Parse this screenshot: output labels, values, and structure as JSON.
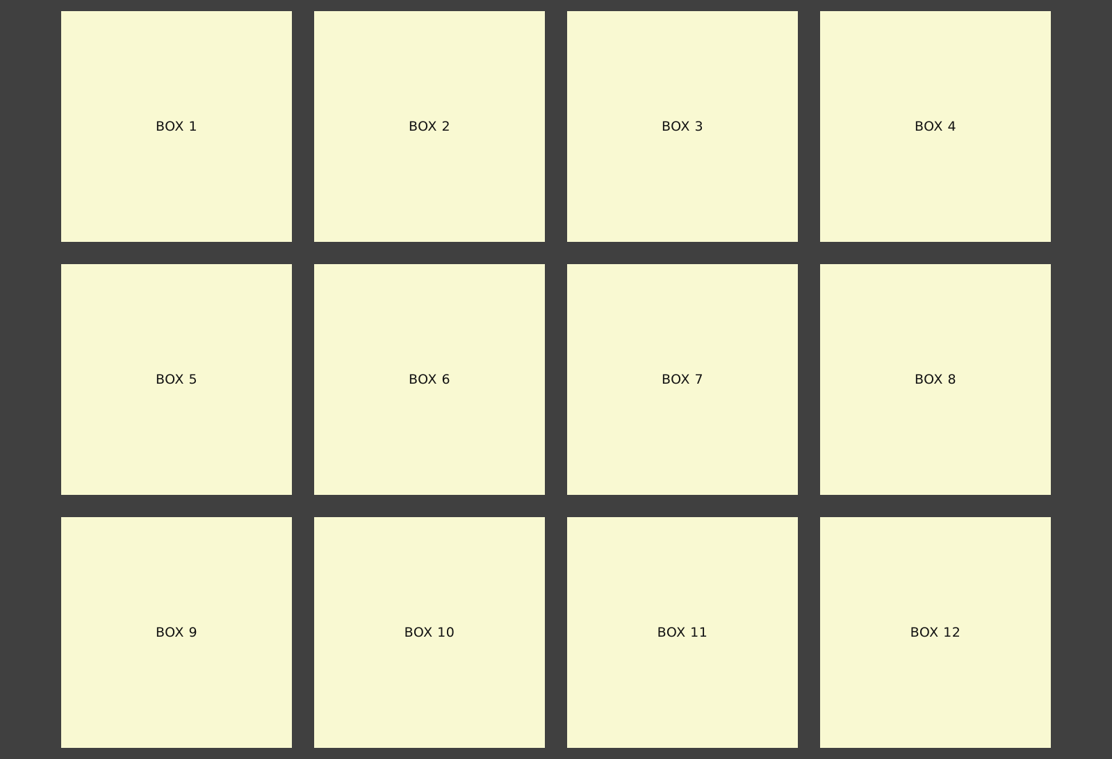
{
  "theme": {
    "background_color": "#404040",
    "box_color": "#f9f9d2",
    "text_color": "#111111"
  },
  "boxes": [
    {
      "label": "BOX 1"
    },
    {
      "label": "BOX 2"
    },
    {
      "label": "BOX 3"
    },
    {
      "label": "BOX 4"
    },
    {
      "label": "BOX 5"
    },
    {
      "label": "BOX 6"
    },
    {
      "label": "BOX 7"
    },
    {
      "label": "BOX 8"
    },
    {
      "label": "BOX 9"
    },
    {
      "label": "BOX 10"
    },
    {
      "label": "BOX 11"
    },
    {
      "label": "BOX 12"
    }
  ]
}
